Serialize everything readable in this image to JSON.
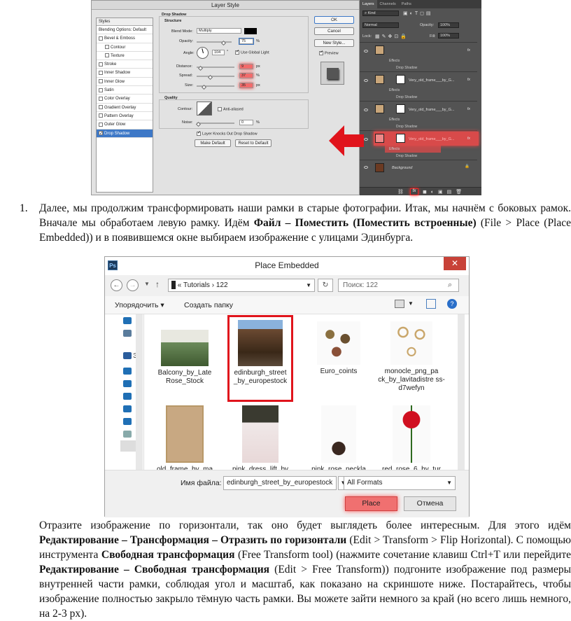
{
  "layer_style": {
    "title": "Layer Style",
    "styles_header": "Styles",
    "blending": "Blending Options: Default",
    "styles": [
      "Bevel & Emboss",
      "Contour",
      "Texture",
      "Stroke",
      "Inner Shadow",
      "Inner Glow",
      "Satin",
      "Color Overlay",
      "Gradient Overlay",
      "Pattern Overlay",
      "Outer Glow",
      "Drop Shadow"
    ],
    "section": "Drop Shadow",
    "structure": "Structure",
    "blend_mode_label": "Blend Mode:",
    "blend_mode": "Multiply",
    "opacity_label": "Opacity:",
    "opacity": "75",
    "angle_label": "Angle:",
    "angle": "104",
    "global_light": "Use Global Light",
    "distance_label": "Distance:",
    "distance": "9",
    "spread_label": "Spread:",
    "spread": "37",
    "size_label": "Size:",
    "size": "35",
    "unit_px": "px",
    "unit_pct": "%",
    "unit_deg": "°",
    "quality": "Quality",
    "contour_label": "Contour:",
    "anti_aliased": "Anti-aliased",
    "noise_label": "Noise:",
    "noise": "0",
    "knocks_out": "Layer Knocks Out Drop Shadow",
    "make_default": "Make Default",
    "reset_default": "Reset to Default",
    "ok": "OK",
    "cancel": "Cancel",
    "new_style": "New Style...",
    "preview": "Preview"
  },
  "layers_panel": {
    "tabs": [
      "Layers",
      "Channels",
      "Paths"
    ],
    "kind": "Kind",
    "mode": "Normal",
    "opacity_label": "Opacity:",
    "opacity": "100%",
    "lock_label": "Lock:",
    "fill_label": "Fill:",
    "fill": "100%",
    "effects": "Effects",
    "drop_shadow": "Drop Shadow",
    "layer_name": "Very_old_frame___by_G...",
    "fx": "fx",
    "background": "Background"
  },
  "step_number": "1.",
  "para1_a": "Далее, мы продолжим трансформировать наши рамки в старые фотографии. Итак, мы начнём с боковых рамок. Вначале мы обработаем левую рамку. Идём ",
  "para1_bold": "Файл – Поместить (Поместить встроенные)",
  "para1_b": " (File > Place (Place Embedded)) и в появившемся окне выбираем изображение с улицами Эдинбурга.",
  "place_dialog": {
    "title": "Place Embedded",
    "ps_icon": "Ps",
    "close": "✕",
    "path_prefix": "«",
    "path_1": "Tutorials",
    "path_sep": "›",
    "path_2": "122",
    "search_placeholder": "Поиск: 122",
    "organize": "Упорядочить",
    "new_folder": "Создать папку",
    "nav_label": "Эт",
    "files": [
      {
        "name": "Balcony_by_Late Rose_Stock"
      },
      {
        "name": "edinburgh_street _by_europestock"
      },
      {
        "name": "Euro_coints"
      },
      {
        "name": "monocle_png_pa ck_by_lavitadistre ss-d7wefyn"
      },
      {
        "name": "old_frame_by_ma"
      },
      {
        "name": "pink_dress_lift_by"
      },
      {
        "name": "pink_rose_neckla"
      },
      {
        "name": "red_rose_6_by_tur"
      }
    ],
    "filename_label": "Имя файла:",
    "filename": "edinburgh_street_by_europestock",
    "filter": "All Formats",
    "place": "Place",
    "cancel": "Отмена"
  },
  "para2_a": "Отразите изображение по горизонтали, так оно будет выглядеть более интересным. Для этого идём ",
  "para2_bold1": "Редактирование – Трансформация – Отразить по горизонтали",
  "para2_b": " (Edit > Transform > Flip Horizontal). С помощью инструмента ",
  "para2_bold2": "Свободная трансформация",
  "para2_c": " (Free Transform tool) (нажмите сочетание клавиш Ctrl+T или перейдите ",
  "para2_bold3": "Редактирование – Свободная трансформация",
  "para2_d": " (Edit > Free Transform)) подгоните изображение под размеры внутренней части рамки, соблюдая угол и масштаб, как показано на скриншоте ниже. Постарайтесь, чтобы изображение полностью закрыло тёмную часть рамки. Вы можете зайти немного за край (но всего лишь немного, на 2-3 px).",
  "colors": {
    "highlight": "#e0141c",
    "ps_dark": "#535353",
    "selection": "#3d78c7"
  }
}
